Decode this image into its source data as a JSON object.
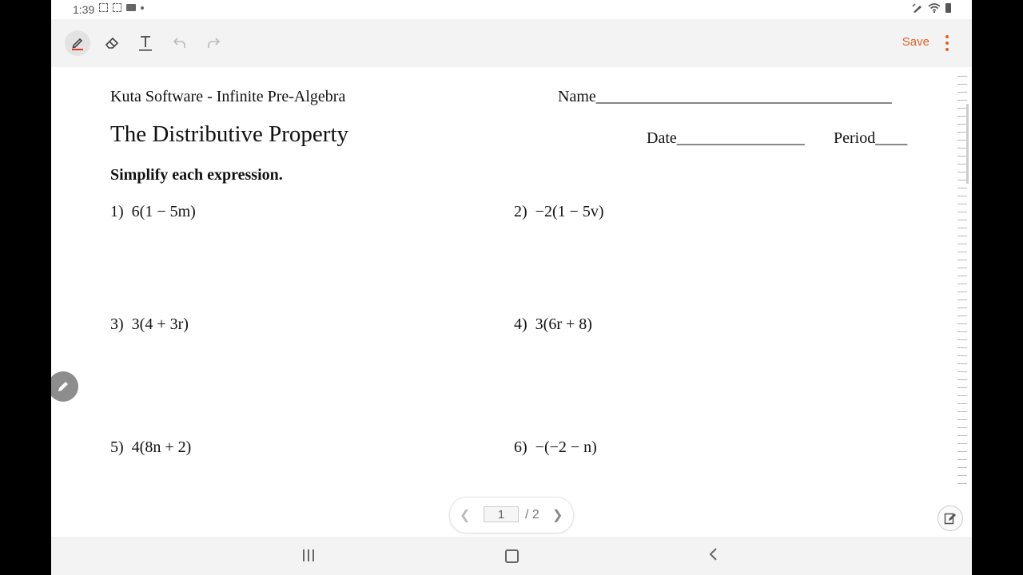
{
  "status_bar": {
    "time": "1:39"
  },
  "toolbar": {
    "save_label": "Save",
    "tools": [
      "pen-icon",
      "eraser-icon",
      "text-tool-icon",
      "undo-icon",
      "redo-icon"
    ]
  },
  "document": {
    "header_left": "Kuta Software - Infinite Pre-Algebra",
    "name_field": "Name_____________________________________",
    "title": "The Distributive Property",
    "date_field": "Date________________",
    "period_field": "Period____",
    "instructions": "Simplify each expression.",
    "problems": [
      {
        "num": "1)",
        "expr": "6(1 − 5m)"
      },
      {
        "num": "2)",
        "expr": "−2(1 − 5v)"
      },
      {
        "num": "3)",
        "expr": "3(4 + 3r)"
      },
      {
        "num": "4)",
        "expr": "3(6r + 8)"
      },
      {
        "num": "5)",
        "expr": "4(8n + 2)"
      },
      {
        "num": "6)",
        "expr": "−(−2 − n)"
      }
    ]
  },
  "page_nav": {
    "current": "1",
    "total": "/ 2"
  },
  "colors": {
    "accent": "#e0612a",
    "toolbar_bg": "#f3f3f3",
    "pen_underline": "#e03b2a"
  }
}
